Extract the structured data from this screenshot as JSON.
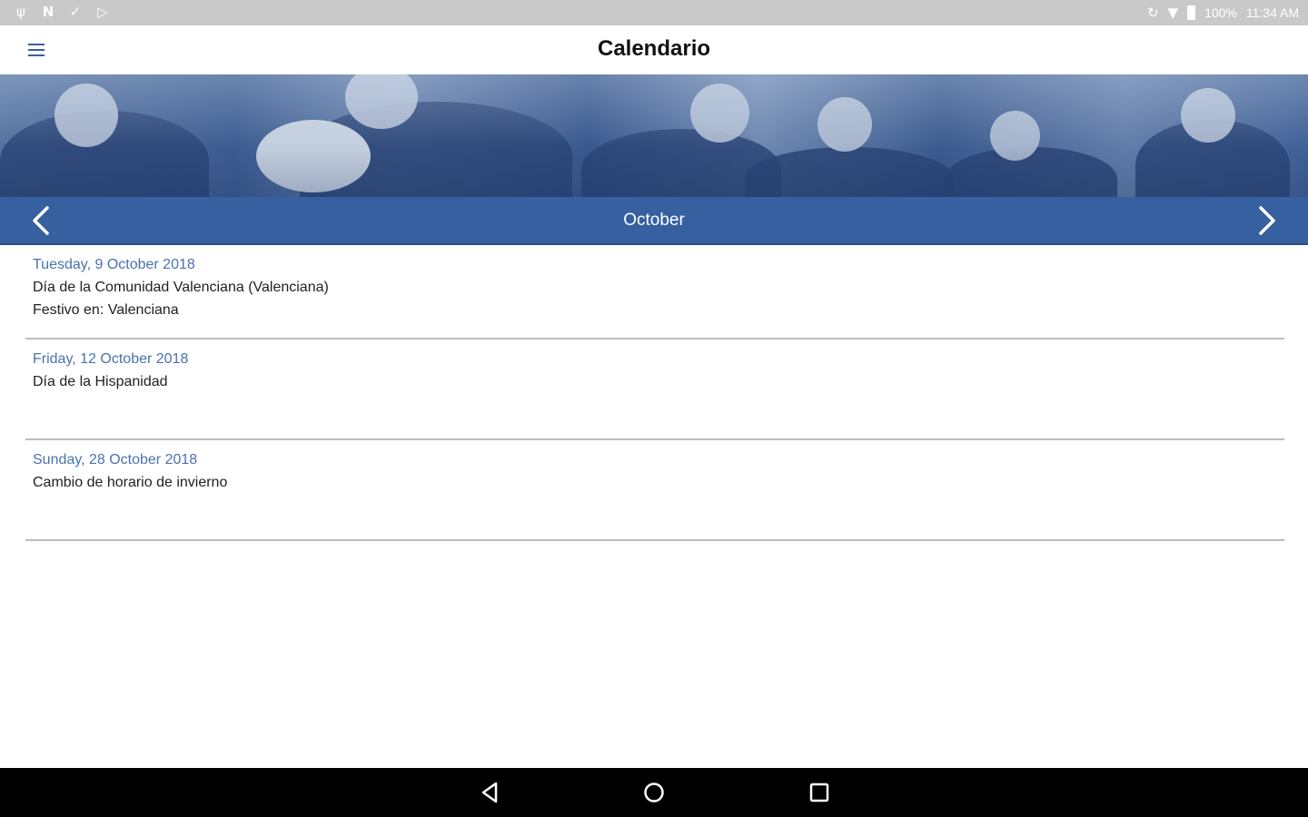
{
  "status_bar": {
    "icons_left": [
      "usb-icon",
      "n-icon",
      "check-icon",
      "play-store-icon"
    ],
    "icons_right": [
      "sync-icon",
      "wifi-icon",
      "battery-icon"
    ],
    "battery": "100%",
    "time": "11:34 AM"
  },
  "app_bar": {
    "title": "Calendario",
    "menu_icon": "hamburger-menu-icon"
  },
  "month_nav": {
    "month": "October",
    "prev_icon": "chevron-left-icon",
    "next_icon": "chevron-right-icon"
  },
  "events": [
    {
      "date": "Tuesday, 9 October 2018",
      "title": "Día de la Comunidad Valenciana (Valenciana)",
      "sub": "Festivo en: Valenciana"
    },
    {
      "date": "Friday, 12 October 2018",
      "title": "Día de la Hispanidad",
      "sub": ""
    },
    {
      "date": "Sunday, 28 October 2018",
      "title": "Cambio de horario de invierno",
      "sub": ""
    }
  ],
  "colors": {
    "accent": "#3660a0",
    "date_text": "#4a72b0",
    "status_bar": "#c9c9c9",
    "nav_bar": "#000000"
  },
  "system_nav": {
    "back_icon": "back-triangle-icon",
    "home_icon": "home-circle-icon",
    "recents_icon": "recents-square-icon"
  }
}
